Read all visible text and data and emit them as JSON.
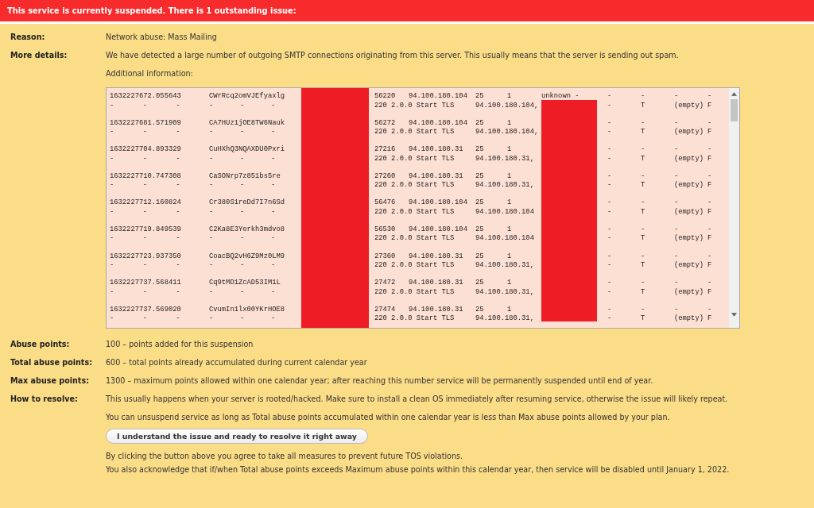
{
  "banner": "This service is currently suspended. There is 1 outstanding issue:",
  "details": [
    {
      "label": "Reason:",
      "text": "Network abuse: Mass Mailing"
    },
    {
      "label": "More details:",
      "text": "We have detected a large number of outgoing SMTP connections originating from this server. This usually means that the server is sending out spam."
    }
  ],
  "additional_label": "Additional information:",
  "log_rows": [
    {
      "ts": "1632227672.055643",
      "uid": "CWrRcq2omVJEfyaxlg",
      "port": "56220",
      "ip": "94.100.180.104",
      "c1": "25",
      "c2": "1",
      "c3": "unknown -",
      "c4": "-",
      "c5": "-",
      "c6": "-",
      "c7": "-",
      "sub": [
        "-",
        "-",
        "-",
        "-",
        "-",
        "-"
      ],
      "msg": "220 2.0.0 Start TLS",
      "ip2": "94.100.180.104,",
      "s1": "-",
      "s2": "T",
      "s3": "(empty)",
      "s4": "F"
    },
    {
      "ts": "1632227681.571909",
      "uid": "CA7HUz1jOE8TW6Nauk",
      "port": "56272",
      "ip": "94.100.180.104",
      "c1": "25",
      "c2": "1",
      "c4": "-",
      "c5": "-",
      "c6": "-",
      "c7": "-",
      "sub": [
        "-",
        "-",
        "-",
        "-",
        "-",
        "-"
      ],
      "msg": "220 2.0.0 Start TLS",
      "ip2": "94.100.180.104,",
      "s1": "-",
      "s2": "T",
      "s3": "(empty)",
      "s4": "F"
    },
    {
      "ts": "1632227704.893329",
      "uid": "CuHXhQ3NQAXDU0Pxri",
      "port": "27216",
      "ip": "94.100.180.31",
      "c1": "25",
      "c2": "1",
      "c4": "-",
      "c5": "-",
      "c6": "-",
      "c7": "-",
      "sub": [
        "-",
        "-",
        "-",
        "-",
        "-",
        "-"
      ],
      "msg": "220 2.0.0 Start TLS",
      "ip2": "94.100.180.31,",
      "s1": "-",
      "s2": "T",
      "s3": "(empty)",
      "s4": "F"
    },
    {
      "ts": "1632227710.747308",
      "uid": "CaSONrp7z851bs5re",
      "port": "27260",
      "ip": "94.100.180.31",
      "c1": "25",
      "c2": "1",
      "c4": "-",
      "c5": "-",
      "c6": "-",
      "c7": "-",
      "sub": [
        "-",
        "-",
        "-",
        "-",
        "-",
        "-"
      ],
      "msg": "220 2.0.0 Start TLS",
      "ip2": "94.100.180.31,",
      "s1": "-",
      "s2": "T",
      "s3": "(empty)",
      "s4": "F"
    },
    {
      "ts": "1632227712.160824",
      "uid": "Cr380S1reDd7I7n6Sd",
      "port": "56476",
      "ip": "94.100.180.104",
      "c1": "25",
      "c2": "1",
      "c4": "-",
      "c5": "-",
      "c6": "-",
      "c7": "-",
      "sub": [
        "-",
        "-",
        "-",
        "-",
        "-",
        "-"
      ],
      "msg": "220 2.0.0 Start TLS",
      "ip2": "94.100.180.104",
      "s1": "-",
      "s2": "T",
      "s3": "(empty)",
      "s4": "F"
    },
    {
      "ts": "1632227719.849539",
      "uid": "C2Ka8E3Yerkh3mdvo8",
      "port": "56530",
      "ip": "94.100.180.104",
      "c1": "25",
      "c2": "1",
      "c4": "-",
      "c5": "-",
      "c6": "-",
      "c7": "-",
      "sub": [
        "-",
        "-",
        "-",
        "-",
        "-",
        "-"
      ],
      "msg": "220 2.0.0 Start TLS",
      "ip2": "94.100.180.104",
      "s1": "-",
      "s2": "T",
      "s3": "(empty)",
      "s4": "F"
    },
    {
      "ts": "1632227723.937350",
      "uid": "CoacBQ2vH6Z9Mz0LM9",
      "port": "27360",
      "ip": "94.100.180.31",
      "c1": "25",
      "c2": "1",
      "c4": "-",
      "c5": "-",
      "c6": "-",
      "c7": "-",
      "sub": [
        "-",
        "-",
        "-",
        "-",
        "-",
        "-"
      ],
      "msg": "220 2.0.0 Start TLS",
      "ip2": "94.100.180.31,",
      "s1": "-",
      "s2": "T",
      "s3": "(empty)",
      "s4": "F"
    },
    {
      "ts": "1632227737.568411",
      "uid": "Cq9tMD1ZcAD53IM1L",
      "port": "27472",
      "ip": "94.100.180.31",
      "c1": "25",
      "c2": "1",
      "c4": "-",
      "c5": "-",
      "c6": "-",
      "c7": "-",
      "sub": [
        "-",
        "-",
        "-",
        "-",
        "-",
        "-"
      ],
      "msg": "220 2.0.0 Start TLS",
      "ip2": "94.100.180.31,",
      "s1": "-",
      "s2": "T",
      "s3": "(empty)",
      "s4": "F"
    },
    {
      "ts": "1632227737.569020",
      "uid": "CvumIn1lx00YKrHOE8",
      "port": "27474",
      "ip": "94.100.180.31",
      "c1": "25",
      "c2": "1",
      "c4": "-",
      "c5": "-",
      "c6": "-",
      "c7": "-",
      "sub": [
        "-",
        "-",
        "-",
        "-",
        "-",
        "-"
      ],
      "msg": "220 2.0.0 Start TLS",
      "ip2": "94.100.180.31,",
      "s1": "-",
      "s2": "T",
      "s3": "(empty)",
      "s4": "F"
    }
  ],
  "points": [
    {
      "label": "Abuse points:",
      "text": "100 – points added for this suspension"
    },
    {
      "label": "Total abuse points:",
      "text": "600 – total points already accumulated during current calendar year"
    },
    {
      "label": "Max abuse points:",
      "text": "1300 – maximum points allowed within one calendar year; after reaching this number service will be permanently suspended until end of year."
    },
    {
      "label": "How to resolve:",
      "text": "This usually happens when your server is rooted/hacked. Make sure to install a clean OS immediately after resuming service, otherwise the issue will likely repeat."
    }
  ],
  "unsuspend_note": "You can unsuspend service as long as Total abuse points accumulated within one calendar year is less than Max abuse points allowed by your plan.",
  "resolve_button": "I understand the issue and ready to resolve it right away",
  "agreement": [
    "By clicking the button above you agree to take all measures to prevent future TOS violations.",
    "You also acknowledge that if/when Total abuse points exceeds Maximum abuse points within this calendar year, then service will be disabled until January 1, 2022."
  ]
}
